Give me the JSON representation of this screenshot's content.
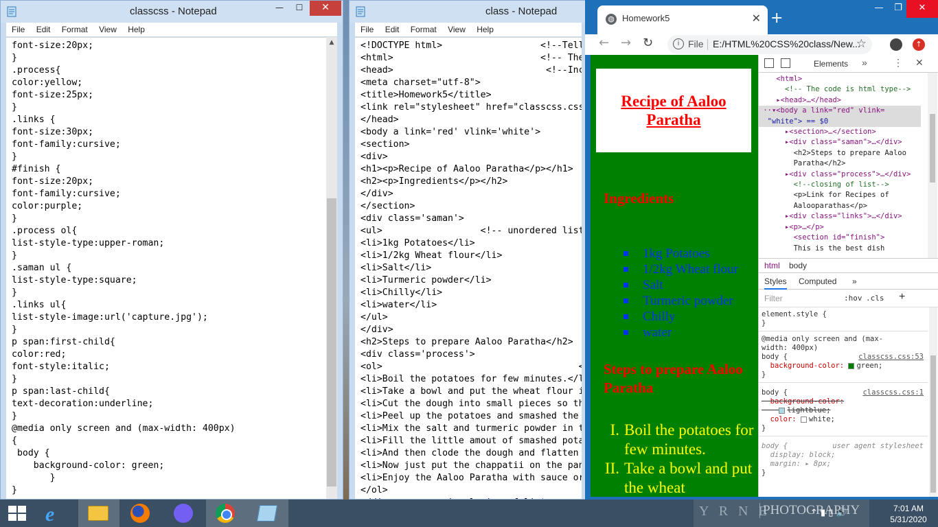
{
  "notepad_left": {
    "title": "classcss - Notepad",
    "menu": [
      "File",
      "Edit",
      "Format",
      "View",
      "Help"
    ],
    "lines": [
      "font-size:20px;",
      "}",
      ".process{",
      "color:yellow;",
      "font-size:25px;",
      "}",
      ".links {",
      "font-size:30px;",
      "font-family:cursive;",
      "}",
      "#finish {",
      "font-size:20px;",
      "font-family:cursive;",
      "color:purple;",
      "}",
      ".process ol{",
      "list-style-type:upper-roman;",
      "}",
      ".saman ul {",
      "list-style-type:square;",
      "}",
      ".links ul{",
      "list-style-image:url('capture.jpg');",
      "}",
      "p span:first-child{",
      "color:red;",
      "font-style:italic;",
      "}",
      "p span:last-child{",
      "text-decoration:underline;",
      "}",
      "@media only screen and (max-width: 400px)",
      "{",
      " body {",
      "    background-color: green;",
      "       }",
      "}"
    ]
  },
  "notepad_right": {
    "title": "class - Notepad",
    "menu": [
      "File",
      "Edit",
      "Format",
      "View",
      "Help"
    ],
    "lines": [
      "<!DOCTYPE html>                  <!--Tells",
      "<html>                           <!-- The",
      "<head>                            <!--Incl",
      "<meta charset=\"utf-8\">",
      "<title>Homework5</title>",
      "<link rel=\"stylesheet\" href=\"classcss.css",
      "</head>",
      "<body a link='red' vlink='white'>",
      "<section>",
      "<div>",
      "<h1><p>Recipe of Aaloo Paratha</p></h1>",
      "<h2><p>Ingredients</p></h2>",
      "</div>",
      "</section>",
      "<div class='saman'>",
      "<ul>                  <!-- unordered list",
      "<li>1kg Potatoes</li>",
      "<li>1/2kg Wheat flour</li>",
      "<li>Salt</li>",
      "<li>Turmeric powder</li>",
      "<li>Chilly</li>",
      "<li>water</li>",
      "</ul>",
      "</div>",
      "<h2>Steps to prepare Aaloo Paratha</h2>",
      "<div class='process'>",
      "<ol>                                    <",
      "<li>Boil the potatoes for few minutes.</l",
      "<li>Take a bowl and put the wheat flour i",
      "<li>Cut the dough into small pieces so th",
      "<li>Peel up the potatoes and smashed the",
      "<li>Mix the salt and turmeric powder in t",
      "<li>Fill the little amout of smashed pota",
      "<li>And then clode the dough and flatten",
      "<li>Now just put the chappatii on the pan",
      "<li>Enjoy the Aaloo Paratha with sauce or",
      "</ol>",
      "</div>         <!--closing of list-->"
    ]
  },
  "chrome": {
    "tab_title": "Homework5",
    "new_tab": "+",
    "url_scheme": "File",
    "url": "E:/HTML%20CSS%20class/New...",
    "page": {
      "h1": "Recipe of Aaloo Paratha",
      "ingredients_heading": "Ingredients",
      "ingredients": [
        "1kg Potatoes",
        "1/2kg Wheat flour",
        "Salt",
        "Turmeric powder",
        "Chilly",
        "water"
      ],
      "steps_heading": "Steps to prepare Aaloo Paratha",
      "steps": [
        {
          "num": "I.",
          "text": "Boil the potatoes for few minutes."
        },
        {
          "num": "II.",
          "text": "Take a bowl and put the wheat"
        }
      ]
    }
  },
  "devtools": {
    "panel": "Elements",
    "crumbs": [
      "html",
      "body"
    ],
    "style_tabs": [
      "Styles",
      "Computed"
    ],
    "filter_placeholder": "Filter",
    "hov": ":hov",
    "cls": ".cls",
    "dom": {
      "html_open": "<html>",
      "comment_type": "<!-- The code is html type-->",
      "head": "<head>…</head>",
      "body_open": "<body a link=\"red\" vlink=",
      "body_cont": "\"white\"> == $0",
      "section": "<section>…</section>",
      "div_saman": "<div class=\"saman\">…</div>",
      "h2_steps_1": "<h2>Steps to prepare Aaloo",
      "h2_steps_2": "Paratha</h2>",
      "div_process": "<div class=\"process\">…</div>",
      "comment_list": "<!--closing of list-->",
      "p_link_1": "<p>Link for Recipes of",
      "p_link_2": "Aalooparathas</p>",
      "div_links": "<div class=\"links\">…</div>",
      "p_dots": "<p>…</p>",
      "section_finish": "<section id=\"finish\">",
      "text_best": "This is the best dish"
    },
    "rules": {
      "element_style": "element.style {",
      "close": "}",
      "media": "@media only screen and (max-",
      "media2": "width: 400px)",
      "body_sel": "body {",
      "link1": "classcss.css:53",
      "bg_prop": "background-color:",
      "bg_val": "green;",
      "link2": "classcss.css:1",
      "bg_old": "background-color:",
      "bg_old_val": "lightblue;",
      "color_prop": "color:",
      "color_val": "white;",
      "ua_label": "user agent stylesheet",
      "display": "display: block;",
      "margin": "margin: ▸ 8px;"
    }
  },
  "taskbar": {
    "time": "7:01 AM",
    "date": "5/31/2020",
    "tray_text1": "Y R N E",
    "tray_text2": "PHOTOGRAPHY"
  }
}
